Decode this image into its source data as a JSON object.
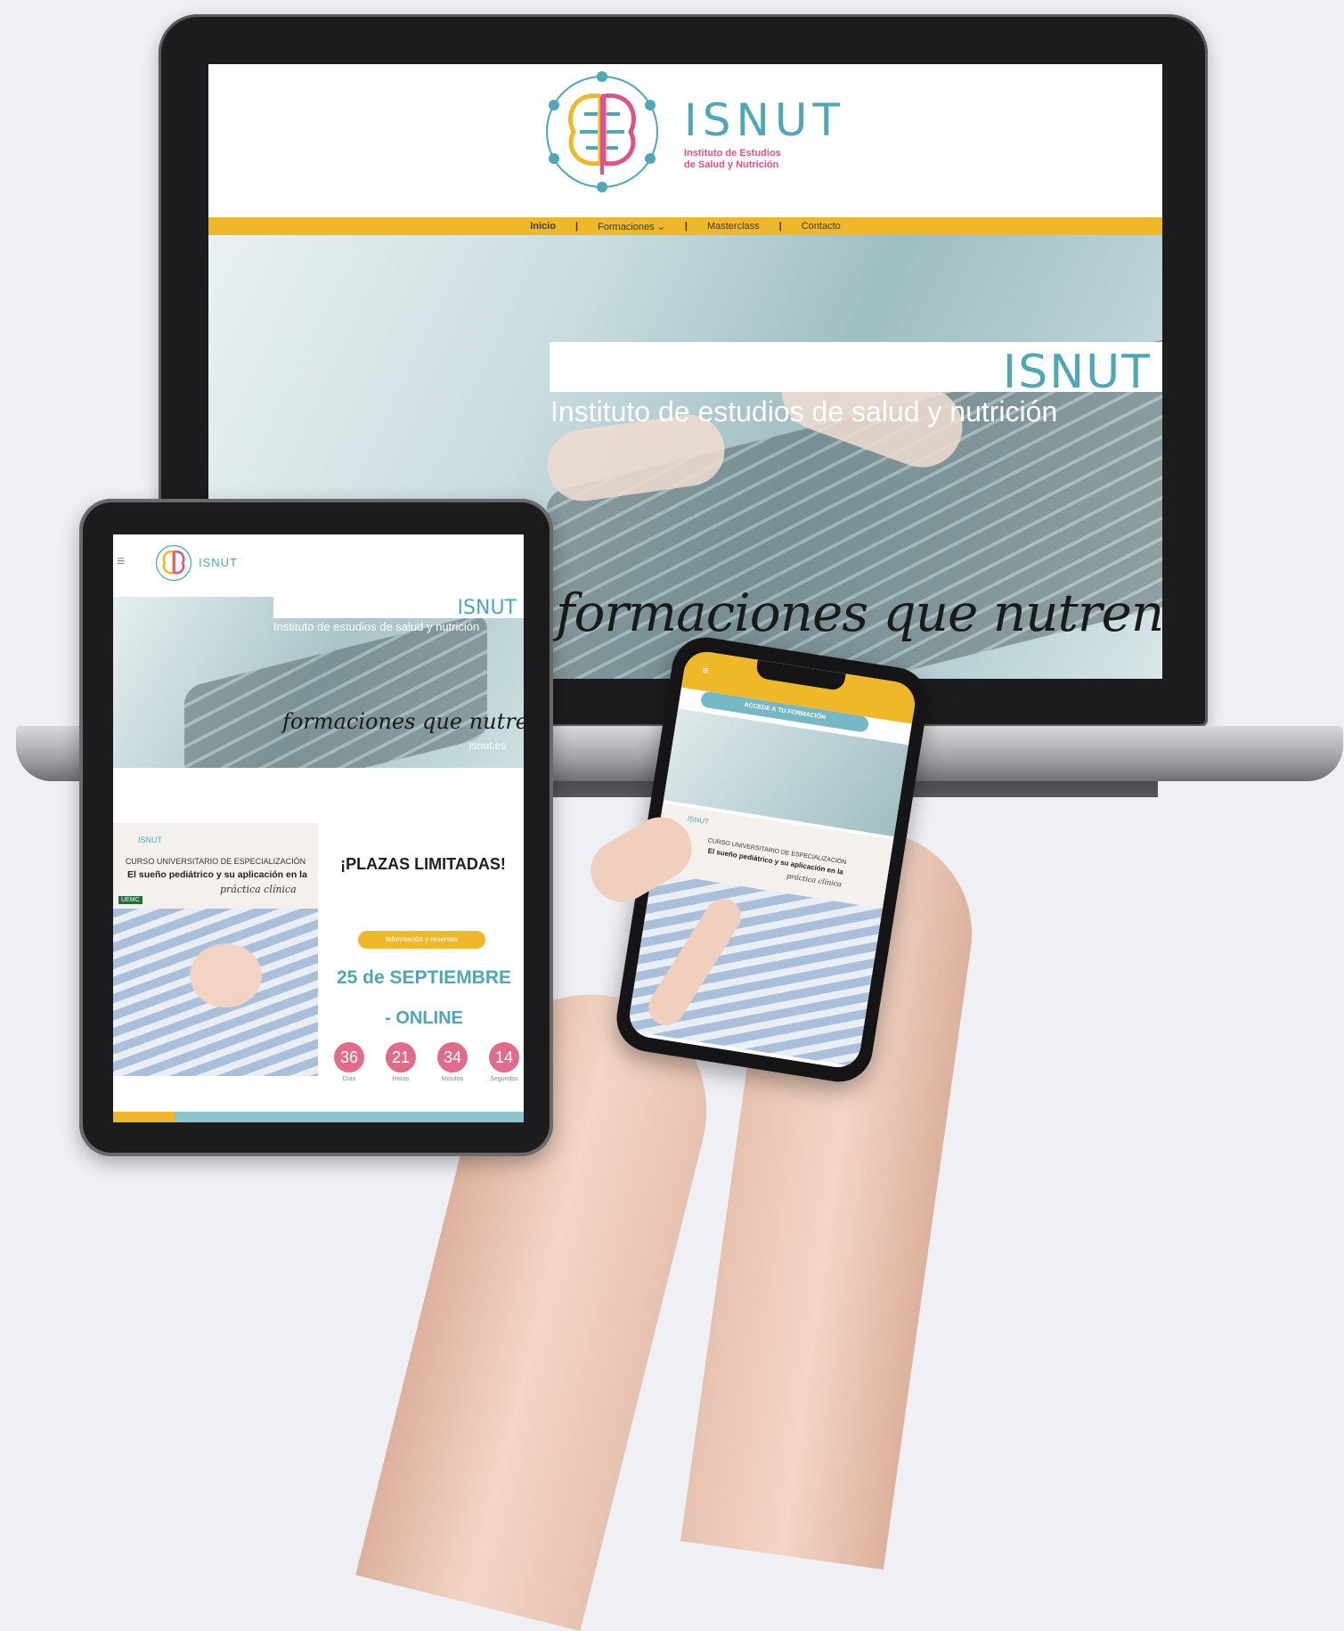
{
  "laptop": {
    "nav": {
      "items": [
        "Inicio",
        "Formaciones",
        "Masterclass",
        "Contacto"
      ],
      "separator": "|",
      "dropdown_icon": "chevron-down-icon"
    },
    "logo": {
      "name": "ISNUT",
      "tagline_line1": "Instituto de Estudios",
      "tagline_line2": "de Salud y Nutrición"
    },
    "hero": {
      "brand": "ISNUT",
      "subtitle": "Instituto de estudios de salud y nutrición",
      "script": "formaciones que nutren"
    }
  },
  "tablet": {
    "header": {
      "menu_icon": "≡",
      "logo": "ISNUT"
    },
    "hero": {
      "brand": "ISNUT",
      "subtitle": "Instituto de estudios de salud y nutrición",
      "script": "formaciones que nutren",
      "url": "isnut.es"
    },
    "course": {
      "logo": "ISNUT",
      "label": "CURSO UNIVERSITARIO DE ESPECIALIZACIÓN",
      "title": "El sueño pediátrico y su aplicación en la",
      "script": "práctica clínica",
      "badge": "UEMC"
    },
    "promo": {
      "plazas": "¡PLAZAS LIMITADAS!",
      "button": "Información y reservas",
      "date": "25 de SEPTIEMBRE",
      "mode": "- ONLINE"
    },
    "countdown": [
      {
        "value": "36",
        "label": "Días"
      },
      {
        "value": "21",
        "label": "Horas"
      },
      {
        "value": "34",
        "label": "Minutos"
      },
      {
        "value": "14",
        "label": "Segundos"
      }
    ]
  },
  "phone": {
    "menu_icon": "≡",
    "cta": "ACCEDE A TU FORMACIÓN",
    "course_label": "CURSO UNIVERSITARIO DE ESPECIALIZACIÓN",
    "course_title": "El sueño pediátrico y su aplicación en la",
    "course_script": "práctica clínica",
    "logo": "ISNUT"
  },
  "colors": {
    "accent_yellow": "#efb72a",
    "brand_teal": "#4fa7b6",
    "countdown_pink": "#e06b8a",
    "background": "#eef0f6"
  }
}
